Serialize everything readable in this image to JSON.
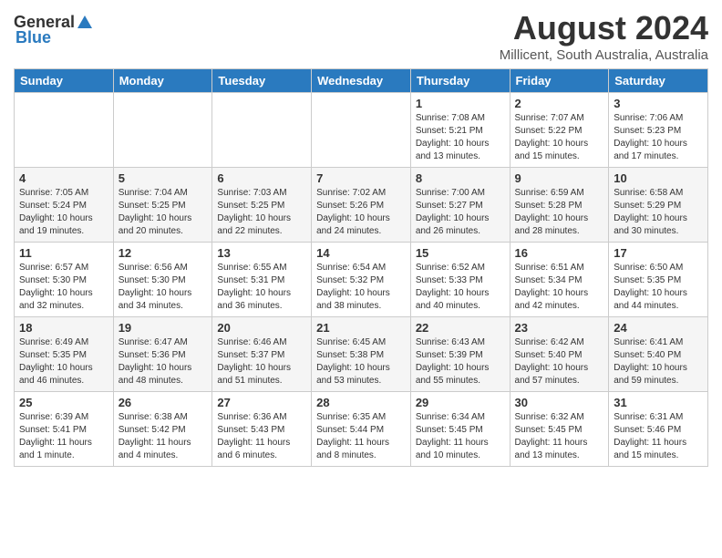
{
  "header": {
    "logo_general": "General",
    "logo_blue": "Blue",
    "title": "August 2024",
    "subtitle": "Millicent, South Australia, Australia"
  },
  "days_of_week": [
    "Sunday",
    "Monday",
    "Tuesday",
    "Wednesday",
    "Thursday",
    "Friday",
    "Saturday"
  ],
  "weeks": [
    [
      {
        "day": "",
        "info": ""
      },
      {
        "day": "",
        "info": ""
      },
      {
        "day": "",
        "info": ""
      },
      {
        "day": "",
        "info": ""
      },
      {
        "day": "1",
        "info": "Sunrise: 7:08 AM\nSunset: 5:21 PM\nDaylight: 10 hours\nand 13 minutes."
      },
      {
        "day": "2",
        "info": "Sunrise: 7:07 AM\nSunset: 5:22 PM\nDaylight: 10 hours\nand 15 minutes."
      },
      {
        "day": "3",
        "info": "Sunrise: 7:06 AM\nSunset: 5:23 PM\nDaylight: 10 hours\nand 17 minutes."
      }
    ],
    [
      {
        "day": "4",
        "info": "Sunrise: 7:05 AM\nSunset: 5:24 PM\nDaylight: 10 hours\nand 19 minutes."
      },
      {
        "day": "5",
        "info": "Sunrise: 7:04 AM\nSunset: 5:25 PM\nDaylight: 10 hours\nand 20 minutes."
      },
      {
        "day": "6",
        "info": "Sunrise: 7:03 AM\nSunset: 5:25 PM\nDaylight: 10 hours\nand 22 minutes."
      },
      {
        "day": "7",
        "info": "Sunrise: 7:02 AM\nSunset: 5:26 PM\nDaylight: 10 hours\nand 24 minutes."
      },
      {
        "day": "8",
        "info": "Sunrise: 7:00 AM\nSunset: 5:27 PM\nDaylight: 10 hours\nand 26 minutes."
      },
      {
        "day": "9",
        "info": "Sunrise: 6:59 AM\nSunset: 5:28 PM\nDaylight: 10 hours\nand 28 minutes."
      },
      {
        "day": "10",
        "info": "Sunrise: 6:58 AM\nSunset: 5:29 PM\nDaylight: 10 hours\nand 30 minutes."
      }
    ],
    [
      {
        "day": "11",
        "info": "Sunrise: 6:57 AM\nSunset: 5:30 PM\nDaylight: 10 hours\nand 32 minutes."
      },
      {
        "day": "12",
        "info": "Sunrise: 6:56 AM\nSunset: 5:30 PM\nDaylight: 10 hours\nand 34 minutes."
      },
      {
        "day": "13",
        "info": "Sunrise: 6:55 AM\nSunset: 5:31 PM\nDaylight: 10 hours\nand 36 minutes."
      },
      {
        "day": "14",
        "info": "Sunrise: 6:54 AM\nSunset: 5:32 PM\nDaylight: 10 hours\nand 38 minutes."
      },
      {
        "day": "15",
        "info": "Sunrise: 6:52 AM\nSunset: 5:33 PM\nDaylight: 10 hours\nand 40 minutes."
      },
      {
        "day": "16",
        "info": "Sunrise: 6:51 AM\nSunset: 5:34 PM\nDaylight: 10 hours\nand 42 minutes."
      },
      {
        "day": "17",
        "info": "Sunrise: 6:50 AM\nSunset: 5:35 PM\nDaylight: 10 hours\nand 44 minutes."
      }
    ],
    [
      {
        "day": "18",
        "info": "Sunrise: 6:49 AM\nSunset: 5:35 PM\nDaylight: 10 hours\nand 46 minutes."
      },
      {
        "day": "19",
        "info": "Sunrise: 6:47 AM\nSunset: 5:36 PM\nDaylight: 10 hours\nand 48 minutes."
      },
      {
        "day": "20",
        "info": "Sunrise: 6:46 AM\nSunset: 5:37 PM\nDaylight: 10 hours\nand 51 minutes."
      },
      {
        "day": "21",
        "info": "Sunrise: 6:45 AM\nSunset: 5:38 PM\nDaylight: 10 hours\nand 53 minutes."
      },
      {
        "day": "22",
        "info": "Sunrise: 6:43 AM\nSunset: 5:39 PM\nDaylight: 10 hours\nand 55 minutes."
      },
      {
        "day": "23",
        "info": "Sunrise: 6:42 AM\nSunset: 5:40 PM\nDaylight: 10 hours\nand 57 minutes."
      },
      {
        "day": "24",
        "info": "Sunrise: 6:41 AM\nSunset: 5:40 PM\nDaylight: 10 hours\nand 59 minutes."
      }
    ],
    [
      {
        "day": "25",
        "info": "Sunrise: 6:39 AM\nSunset: 5:41 PM\nDaylight: 11 hours\nand 1 minute."
      },
      {
        "day": "26",
        "info": "Sunrise: 6:38 AM\nSunset: 5:42 PM\nDaylight: 11 hours\nand 4 minutes."
      },
      {
        "day": "27",
        "info": "Sunrise: 6:36 AM\nSunset: 5:43 PM\nDaylight: 11 hours\nand 6 minutes."
      },
      {
        "day": "28",
        "info": "Sunrise: 6:35 AM\nSunset: 5:44 PM\nDaylight: 11 hours\nand 8 minutes."
      },
      {
        "day": "29",
        "info": "Sunrise: 6:34 AM\nSunset: 5:45 PM\nDaylight: 11 hours\nand 10 minutes."
      },
      {
        "day": "30",
        "info": "Sunrise: 6:32 AM\nSunset: 5:45 PM\nDaylight: 11 hours\nand 13 minutes."
      },
      {
        "day": "31",
        "info": "Sunrise: 6:31 AM\nSunset: 5:46 PM\nDaylight: 11 hours\nand 15 minutes."
      }
    ]
  ]
}
